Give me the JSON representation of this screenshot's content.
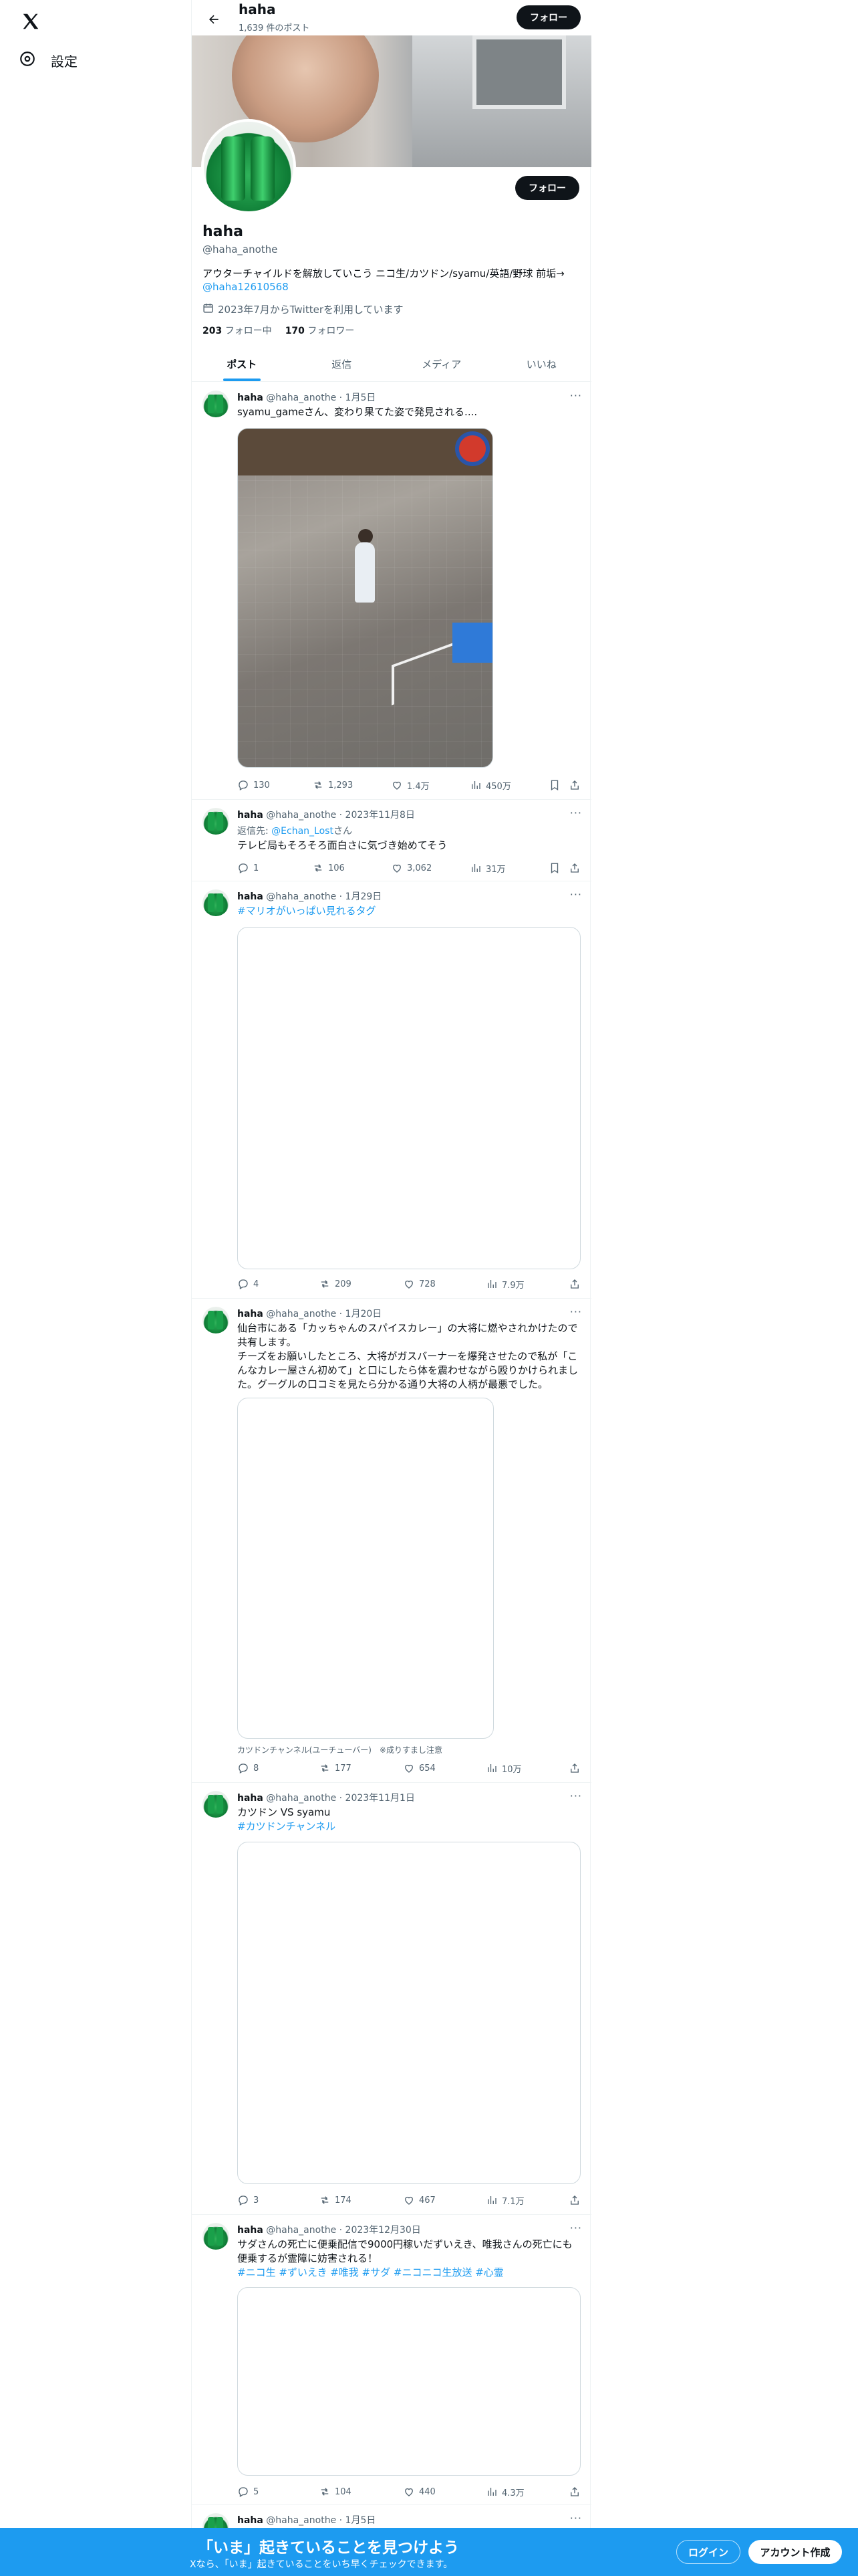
{
  "nav": {
    "settings_label": "設定"
  },
  "topbar": {
    "title": "haha",
    "post_count": "1,639 件のポスト",
    "follow_label": "フォロー"
  },
  "profile": {
    "name": "haha",
    "handle": "@haha_anothe",
    "bio": "アウターチャイルドを解放していこう ニコ生/カツドン/syamu/英語/野球 前垢→",
    "bio_link": "@haha12610568",
    "joined": "2023年7月からTwitterを利用しています",
    "following_count": "203",
    "following_label": "フォロー中",
    "followers_count": "170",
    "followers_label": "フォロワー",
    "follow_label": "フォロー"
  },
  "tabs": [
    "ポスト",
    "返信",
    "メディア",
    "いいね"
  ],
  "posts": [
    {
      "name": "haha",
      "handle": "@haha_anothe",
      "date": "1月5日",
      "text": "syamu_gameさん、変わり果てた姿で発見される....",
      "replies": "130",
      "reposts": "1,293",
      "likes": "1.4万",
      "views": "450万"
    },
    {
      "name": "haha",
      "handle": "@haha_anothe",
      "date": "2023年11月8日",
      "reply_to_prefix": "返信先: ",
      "reply_to": "@Echan_Lost",
      "reply_to_suffix": "さん",
      "text": "テレビ局もそろそろ面白さに気づき始めてそう",
      "replies": "1",
      "reposts": "106",
      "likes": "3,062",
      "views": "31万"
    },
    {
      "name": "haha",
      "handle": "@haha_anothe",
      "date": "1月29日",
      "hashtags": "#マリオがいっぱい見れるタグ",
      "replies": "4",
      "reposts": "209",
      "likes": "728",
      "views": "7.9万"
    },
    {
      "name": "haha",
      "handle": "@haha_anothe",
      "date": "1月20日",
      "text_lines": [
        "仙台市にある「カッちゃんのスパイスカレー」の大将に燃やされかけたので",
        "共有します。",
        "チーズをお願いしたところ、大将がガスバーナーを爆発させたので私が「こ",
        "んなカレー屋さん初めて」と口にしたら体を震わせながら殴りかけられまし",
        "た。グーグルの口コミを見たら分かる通り大将の人柄が最悪でした。"
      ],
      "caption": "カツドンチャンネル(ユーチューバー)　※成りすまし注意",
      "replies": "8",
      "reposts": "177",
      "likes": "654",
      "views": "10万"
    },
    {
      "name": "haha",
      "handle": "@haha_anothe",
      "date": "2023年11月1日",
      "text": "カツドン VS syamu",
      "hashtags": "#カツドンチャンネル",
      "replies": "3",
      "reposts": "174",
      "likes": "467",
      "views": "7.1万"
    },
    {
      "name": "haha",
      "handle": "@haha_anothe",
      "date": "2023年12月30日",
      "text_lines": [
        "サダさんの死亡に便乗配信で9000円稼いだずいえき、唯我さんの死亡にも",
        "便乗するが霊障に妨害される！"
      ],
      "hashtags": "#ニコ生 #ずいえき #唯我 #サダ #ニコニコ生放送 #心霊",
      "replies": "5",
      "reposts": "104",
      "likes": "440",
      "views": "4.3万"
    },
    {
      "name": "haha",
      "handle": "@haha_anothe",
      "date": "1月5日"
    }
  ],
  "bottom_banner": {
    "title": "「いま」起きていることを見つけよう",
    "subtitle": "Xなら、「いま」起きていることをいち早くチェックできます。",
    "login_label": "ログイン",
    "signup_label": "アカウント作成"
  },
  "colors": {
    "accent": "#1d9bf0",
    "text": "#0f1419",
    "muted": "#536471",
    "border": "#eff3f4"
  },
  "icons": [
    "x-logo-icon",
    "gear-icon",
    "back-arrow-icon",
    "calendar-icon",
    "reply-icon",
    "repost-icon",
    "like-icon",
    "views-icon",
    "bookmark-icon",
    "share-icon",
    "more-icon"
  ]
}
